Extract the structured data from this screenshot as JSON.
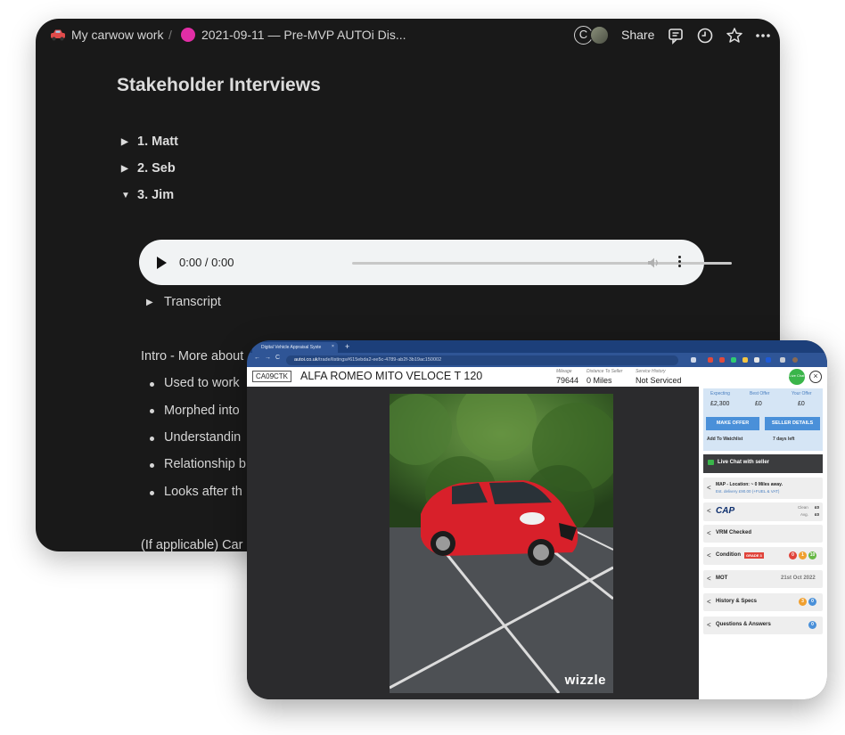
{
  "notion": {
    "breadcrumb": {
      "workspace": "My carwow work",
      "separator": "/",
      "page": "2021-09-11 — Pre-MVP AUTOi Dis..."
    },
    "avatar_initial": "C",
    "share_label": "Share",
    "title": "Stakeholder Interviews",
    "toggles": [
      {
        "label": "1. Matt",
        "expanded": false
      },
      {
        "label": "2. Seb",
        "expanded": false
      },
      {
        "label": "3. Jim",
        "expanded": true
      }
    ],
    "toggle_glyph_collapsed": "▶",
    "toggle_glyph_expanded": "▼",
    "audio": {
      "time": "0:00 / 0:00"
    },
    "transcript_label": "Transcript",
    "intro": "Intro - More about",
    "bullets": [
      "Used to work",
      "Morphed into",
      "Understandin",
      "Relationship b",
      "Looks after th"
    ],
    "footer_text": "(If applicable) Car"
  },
  "browser": {
    "tab_title": "Digital Vehicle Appraisal Syste",
    "tab_close": "×",
    "new_tab": "+",
    "url_host": "autoi.co.uk",
    "url_path": "/trade/listings#615ebda2-ee5c-4789-ab2f-3b19ac150002",
    "nav": {
      "back": "←",
      "forward": "→",
      "reload": "C"
    },
    "registration": "CA09CTK",
    "vehicle_title": "ALFA ROMEO MITO VELOCE T 120",
    "stats": [
      {
        "label": "Mileage",
        "value": "79644"
      },
      {
        "label": "Distance To Seller",
        "value": "0 Miles"
      },
      {
        "label": "Service History",
        "value": "Not Serviced"
      }
    ],
    "photo_watermark": "wizzle"
  },
  "panel": {
    "live_badge": "Live Chat",
    "close_glyph": "×",
    "offers": [
      {
        "label": "Expecting",
        "value": "£2,300"
      },
      {
        "label": "Best Offer",
        "value": "£0"
      },
      {
        "label": "Your Offer",
        "value": "£0"
      }
    ],
    "make_offer": "MAKE OFFER",
    "seller_details": "SELLER DETAILS",
    "watchlist": "Add To Watchlist",
    "days_left": "7 days left",
    "live_chat": "Live Chat with seller",
    "map": {
      "title": "MAP - Location: ~ 0 Miles away.",
      "subtitle": "Est. delivery £90.00 (+FUEL & VAT)"
    },
    "cap": {
      "logo": "CAP",
      "clean_label": "Clean",
      "clean_value": "£0",
      "avg_label": "Avg.",
      "avg_value": "£0"
    },
    "vrm": "VRM Checked",
    "condition": {
      "label": "Condition",
      "grade": "GRADE 3",
      "counts": [
        "0",
        "1",
        "10"
      ]
    },
    "mot": {
      "label": "MOT",
      "date": "21st Oct 2022"
    },
    "history": {
      "label": "History & Specs",
      "counts": [
        "3",
        "0"
      ]
    },
    "qa": {
      "label": "Questions & Answers",
      "count": "0"
    },
    "chevron": "<"
  }
}
